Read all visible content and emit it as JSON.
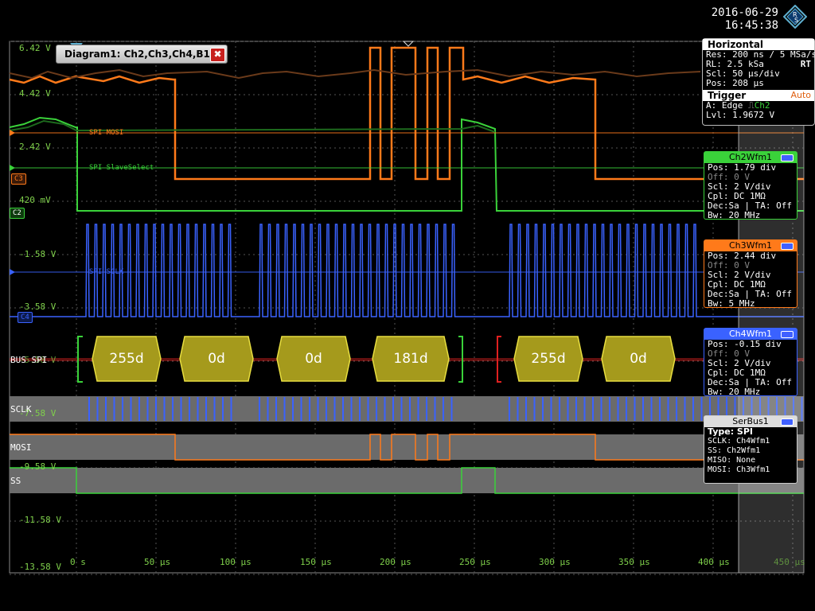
{
  "header": {
    "date": "2016-06-29",
    "time": "16:45:38"
  },
  "diagram_tab": {
    "title": "Diagram1: Ch2,Ch3,Ch4,B1",
    "close_label": "✖"
  },
  "y_axis": [
    "6.42 V",
    "4.42 V",
    "2.42 V",
    "420 mV",
    "-1.58 V",
    "-3.58 V",
    "-5.58 V",
    "-7.58 V",
    "-9.58 V",
    "-11.58 V",
    "-13.58 V"
  ],
  "x_axis": [
    "0 s",
    "50 µs",
    "100 µs",
    "150 µs",
    "200 µs",
    "250 µs",
    "300 µs",
    "350 µs",
    "400 µs",
    "450 µs"
  ],
  "channels": {
    "mosi_label": "SPI MOSI",
    "ss_label": "SPI SlaveSelect",
    "sclk_label": "SPI SCLK",
    "c3": "C3",
    "c2": "C2",
    "c4": "C4"
  },
  "bus": {
    "bus_label": "BUS SPI",
    "rows": [
      "SCLK",
      "MOSI",
      "SS"
    ],
    "frames": [
      "255d",
      "0d",
      "0d",
      "181d",
      "255d",
      "0d"
    ]
  },
  "horizontal": {
    "title": "Horizontal",
    "res": "Res: 200 ns / 5 MSa/s",
    "rl": "RL:  2.5 kSa",
    "rt": "RT",
    "scl": "Scl:  50 µs/div",
    "pos": "Pos:  208 µs",
    "trigger_title": "Trigger",
    "trigger_mode": "Auto",
    "trig_a": "A:    Edge",
    "trig_src": "Ch2",
    "lvl": "Lvl:  1.9672 V"
  },
  "ch2": {
    "title": "Ch2Wfm1",
    "rows": [
      "Pos: 1.79 div",
      "Off: 0 V",
      "Scl: 2 V/div",
      "Cpl: DC 1MΩ",
      "Dec:Sa | TA: Off",
      "Bw: 20 MHz"
    ]
  },
  "ch3": {
    "title": "Ch3Wfm1",
    "rows": [
      "Pos: 2.44 div",
      "Off: 0 V",
      "Scl: 2 V/div",
      "Cpl: DC 1MΩ",
      "Dec:Sa | TA: Off",
      "Bw: 5 MHz"
    ]
  },
  "ch4": {
    "title": "Ch4Wfm1",
    "rows": [
      "Pos: -0.15 div",
      "Off: 0 V",
      "Scl: 2 V/div",
      "Cpl: DC 1MΩ",
      "Dec:Sa | TA: Off",
      "Bw: 20 MHz"
    ]
  },
  "serbus": {
    "title": "SerBus1",
    "type": "Type: SPI",
    "rows": [
      "SCLK: Ch4Wfm1",
      "SS:    Ch2Wfm1",
      "MISO: None",
      "MOSI: Ch3Wfm1"
    ]
  },
  "colors": {
    "ch2": "#3ad23a",
    "ch3": "#ff7a1a",
    "ch4": "#3a62ff",
    "grid": "#6a6a6a",
    "frame": "#a59a1c",
    "axis_label": "#7fd04b"
  }
}
